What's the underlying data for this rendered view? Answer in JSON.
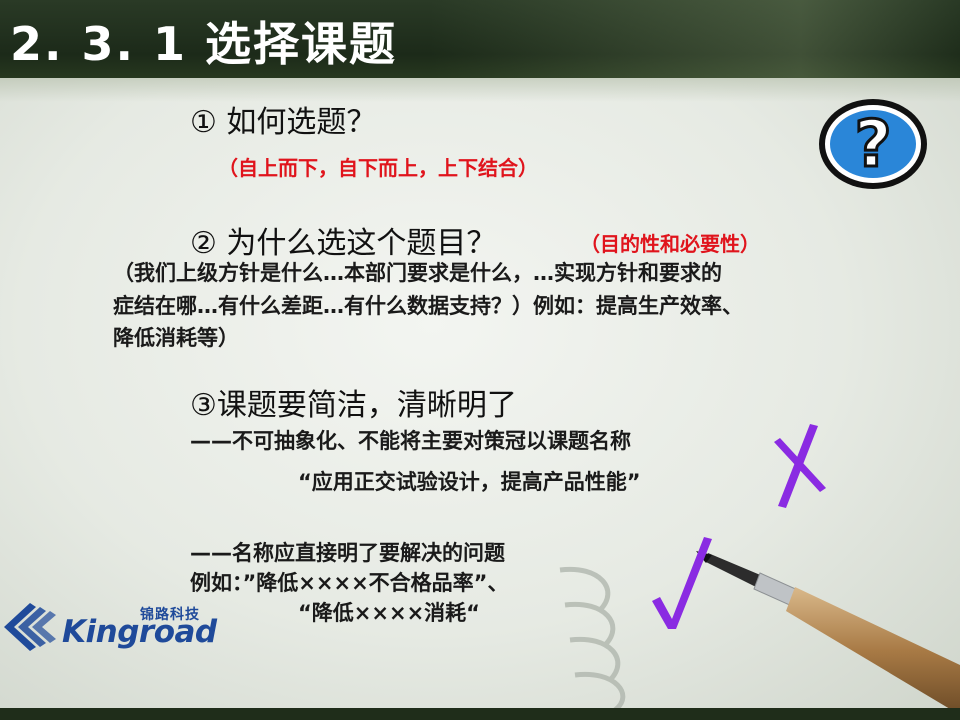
{
  "slide": {
    "title": "2. 3. 1  选择课题"
  },
  "section1": {
    "heading": "①  如何选题？",
    "note": "（自上而下，自下而上，上下结合）"
  },
  "section2": {
    "heading": "②  为什么选这个题目？",
    "note": "（目的性和必要性）",
    "lines": [
      "（我们上级方针是什么…本部门要求是什么，…实现方针和要求的",
      "症结在哪…有什么差距…有什么数据支持？）例如：提高生产效率、",
      "降低消耗等）"
    ]
  },
  "section3": {
    "heading": "③课题要简洁，清晰明了",
    "point1": "——不可抽象化、不能将主要对策冠以课题名称",
    "bad_example": "“应用正交试验设计，提高产品性能”",
    "point2": "——名称应直接明了要解决的问题",
    "good_example1": "例如：”降低××××不合格品率”、",
    "good_example2": "“降低××××消耗“"
  },
  "logo": {
    "cn": "锦路科技",
    "en": "Kingroad"
  },
  "icons": {
    "question": "question-mark-icon",
    "cross": "cross-mark-icon",
    "check": "check-mark-icon"
  },
  "colors": {
    "title_bar": "#1c2a19",
    "note_red": "#e0141c",
    "mark_purple": "#8a2be2",
    "icon_blue": "#2a86d8",
    "logo_blue": "#1f4a9a"
  }
}
